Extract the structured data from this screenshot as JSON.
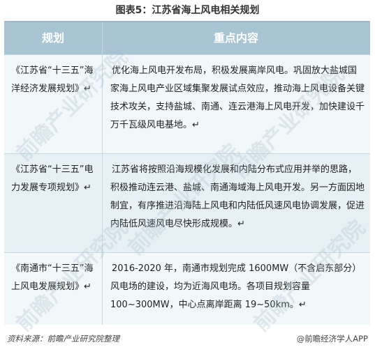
{
  "title": "图表5：江苏省海上风电相关规划",
  "table": {
    "headers": [
      "规划",
      "重点内容"
    ],
    "rows": [
      {
        "plan": "《江苏省“十三五”海洋经济发展规划》↵",
        "content": "优化海上风电开发布局，积极发展离岸风电。巩固放大盐城国家海上风电产业区域集聚发展试点效应，推动海上风电设备关键技术攻关，支持盐城、南通、连云港海上风电开发，加快建设千万千瓦级风电基地。↵"
      },
      {
        "plan": "《江苏省“十三五”电力发展专项规划》↵",
        "content": "江苏省将按照沿海规模化发展和内陆分布式应用并举的思路，积极推动连云港、盐城、南通海域海上风电开发。另一方面因地制宜，有序推进沿海陆上风电和内陆低风速风电协调发展，促进内陆低风速风电尽快形成规模。↵"
      },
      {
        "plan": "《南通市“十三五”海上风电发展规划》↵",
        "content": "2016-2020 年，南通市规划完成 1600MW（不含启东部分）风电场的建设，均为近海风电场。各项目规划容量100~300MW，中心点离岸距离 19~50km。↵"
      }
    ]
  },
  "watermark": "前瞻产业研究院",
  "source": "资料来源：前瞻产业研究院整理",
  "brand": "@前瞻经济学人APP"
}
